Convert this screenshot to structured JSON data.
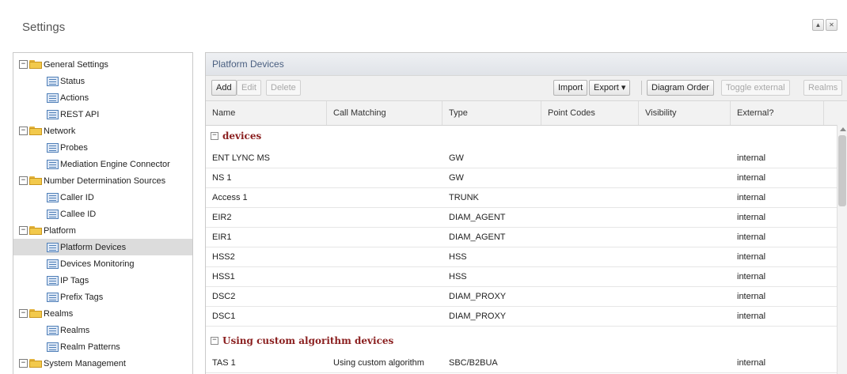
{
  "window": {
    "title": "Settings",
    "buttons": [
      "▲",
      "✕"
    ]
  },
  "tree": [
    {
      "label": "General Settings",
      "type": "folder",
      "expanded": true
    },
    {
      "label": "Status",
      "type": "leaf"
    },
    {
      "label": "Actions",
      "type": "leaf"
    },
    {
      "label": "REST API",
      "type": "leaf"
    },
    {
      "label": "Network",
      "type": "folder",
      "expanded": true
    },
    {
      "label": "Probes",
      "type": "leaf"
    },
    {
      "label": "Mediation Engine Connector",
      "type": "leaf"
    },
    {
      "label": "Number Determination Sources",
      "type": "folder",
      "expanded": true
    },
    {
      "label": "Caller ID",
      "type": "leaf"
    },
    {
      "label": "Callee ID",
      "type": "leaf"
    },
    {
      "label": "Platform",
      "type": "folder",
      "expanded": true
    },
    {
      "label": "Platform Devices",
      "type": "leaf",
      "selected": true
    },
    {
      "label": "Devices Monitoring",
      "type": "leaf"
    },
    {
      "label": "IP Tags",
      "type": "leaf"
    },
    {
      "label": "Prefix Tags",
      "type": "leaf"
    },
    {
      "label": "Realms",
      "type": "folder",
      "expanded": true
    },
    {
      "label": "Realms",
      "type": "leaf"
    },
    {
      "label": "Realm Patterns",
      "type": "leaf"
    },
    {
      "label": "System Management",
      "type": "folder",
      "expanded": true
    }
  ],
  "panel": {
    "title": "Platform Devices",
    "toolbar": {
      "add": "Add",
      "edit": "Edit",
      "delete": "Delete",
      "import": "Import",
      "export": "Export ▾",
      "diagram_order": "Diagram Order",
      "toggle_external": "Toggle external",
      "realms": "Realms"
    },
    "columns": [
      "Name",
      "Call Matching",
      "Type",
      "Point Codes",
      "Visibility",
      "External?"
    ],
    "groups": [
      {
        "title": "devices",
        "rows": [
          {
            "name": "ENT LYNC MS",
            "call_matching": "",
            "type": "GW",
            "point_codes": "",
            "visibility": "",
            "external": "internal"
          },
          {
            "name": "NS 1",
            "call_matching": "",
            "type": "GW",
            "point_codes": "",
            "visibility": "",
            "external": "internal"
          },
          {
            "name": "Access 1",
            "call_matching": "",
            "type": "TRUNK",
            "point_codes": "",
            "visibility": "",
            "external": "internal"
          },
          {
            "name": "EIR2",
            "call_matching": "",
            "type": "DIAM_AGENT",
            "point_codes": "",
            "visibility": "",
            "external": "internal"
          },
          {
            "name": "EIR1",
            "call_matching": "",
            "type": "DIAM_AGENT",
            "point_codes": "",
            "visibility": "",
            "external": "internal"
          },
          {
            "name": "HSS2",
            "call_matching": "",
            "type": "HSS",
            "point_codes": "",
            "visibility": "",
            "external": "internal"
          },
          {
            "name": "HSS1",
            "call_matching": "",
            "type": "HSS",
            "point_codes": "",
            "visibility": "",
            "external": "internal"
          },
          {
            "name": "DSC2",
            "call_matching": "",
            "type": "DIAM_PROXY",
            "point_codes": "",
            "visibility": "",
            "external": "internal"
          },
          {
            "name": "DSC1",
            "call_matching": "",
            "type": "DIAM_PROXY",
            "point_codes": "",
            "visibility": "",
            "external": "internal"
          }
        ]
      },
      {
        "title": "Using custom algorithm devices",
        "rows": [
          {
            "name": "TAS 1",
            "call_matching": "Using custom algorithm",
            "type": "SBC/B2BUA",
            "point_codes": "",
            "visibility": "",
            "external": "internal"
          }
        ]
      }
    ]
  }
}
